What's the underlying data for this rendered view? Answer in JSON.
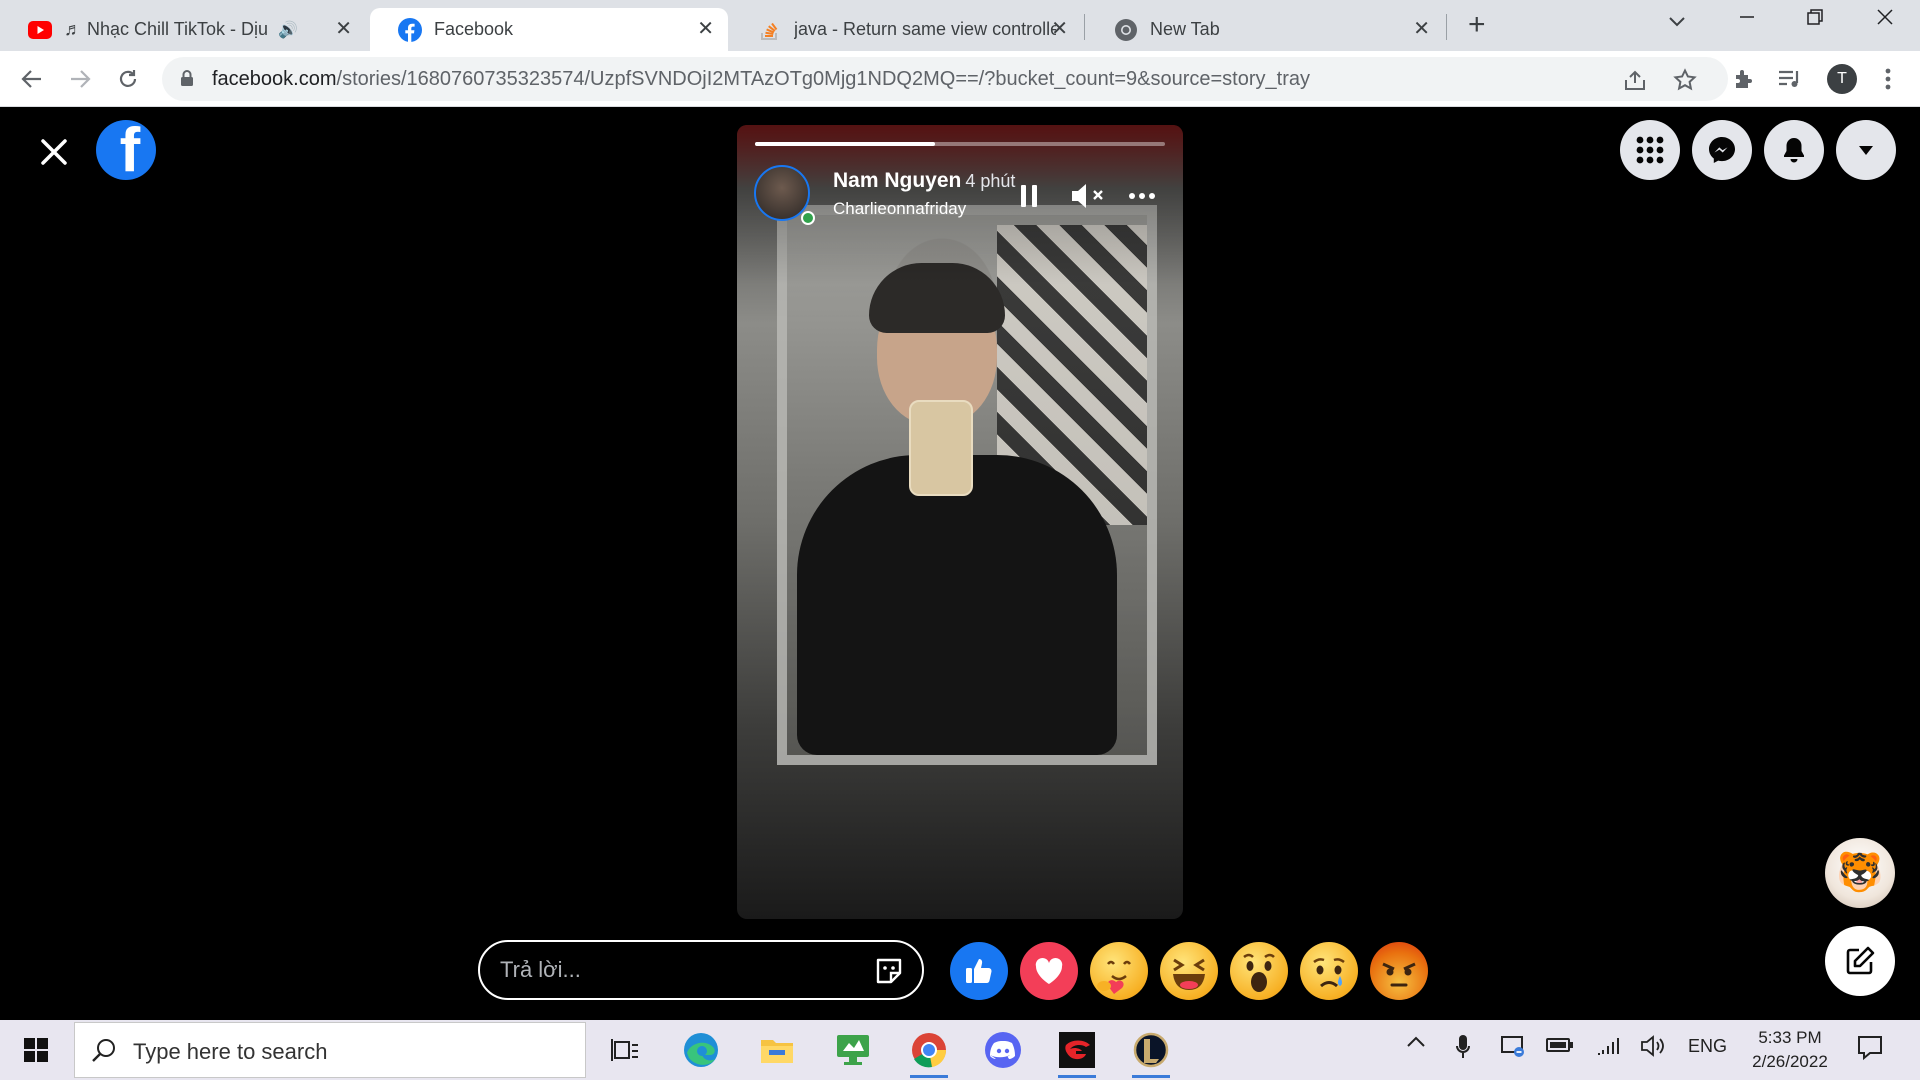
{
  "browser": {
    "tabs": [
      {
        "title": "♬ Nhạc Chill TikTok - Dịu Dà",
        "icon": "youtube-icon",
        "audio": true
      },
      {
        "title": "Facebook",
        "icon": "facebook-icon",
        "active": true
      },
      {
        "title": "java - Return same view controlle",
        "icon": "stackoverflow-icon"
      },
      {
        "title": "New Tab",
        "icon": "chrome-icon"
      }
    ],
    "url_host": "facebook.com",
    "url_path": "/stories/1680760735323574/UzpfSVNDOjI2MTAzOTg0Mjg1NDQ2MQ==/?bucket_count=9&source=story_tray",
    "profile_initial": "T"
  },
  "story": {
    "author": "Nam Nguyen",
    "time": "4 phút",
    "subtitle": "Charlieonnafriday",
    "progress": 0.44
  },
  "reply": {
    "placeholder": "Trả lời..."
  },
  "reactions": [
    "like",
    "love",
    "care",
    "haha",
    "wow",
    "sad",
    "angry"
  ],
  "taskbar": {
    "search_placeholder": "Type here to search",
    "language": "ENG",
    "time": "5:33 PM",
    "date": "2/26/2022"
  },
  "colors": {
    "facebook_blue": "#1877f2",
    "love_red": "#f33e58",
    "angry_orange": "#e9710f"
  }
}
